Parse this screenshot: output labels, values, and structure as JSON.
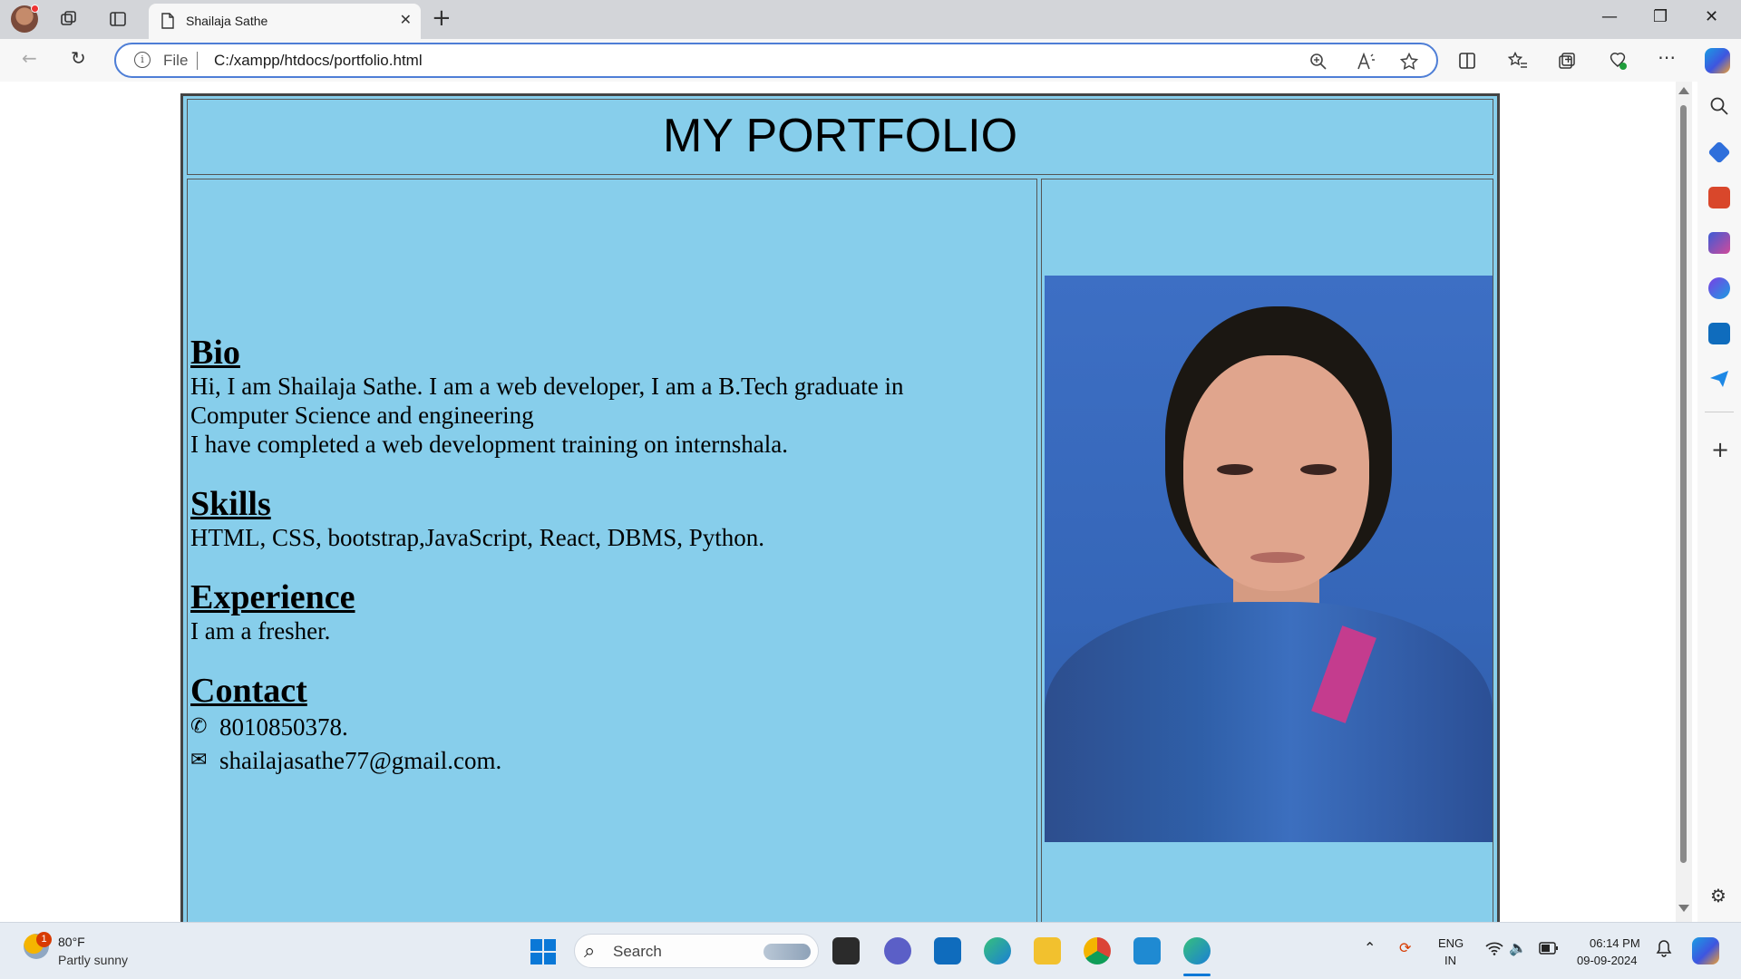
{
  "browser": {
    "tab_title": "Shailaja Sathe",
    "tab_close": "✕",
    "new_tab": "+",
    "address_scheme_label": "File",
    "address_url": "C:/xampp/htdocs/portfolio.html",
    "window_controls": {
      "minimize": "—",
      "maximize": "❐",
      "close": "✕"
    }
  },
  "page": {
    "title": "MY PORTFOLIO",
    "bio": {
      "heading": "Bio",
      "line1": "Hi, I am Shailaja Sathe. I am a web developer, I am a B.Tech graduate in",
      "line2": "Computer Science and engineering",
      "line3": "I have completed a web development training on internshala."
    },
    "skills": {
      "heading": "Skills",
      "text": "HTML, CSS, bootstrap,JavaScript, React, DBMS, Python."
    },
    "experience": {
      "heading": "Experience",
      "text": "I am a fresher."
    },
    "contact": {
      "heading": "Contact",
      "phone_icon": "✆",
      "phone": "8010850378.",
      "email_icon": "✉",
      "email": "shailajasathe77@gmail.com."
    },
    "background_color": "#87ceeb"
  },
  "taskbar": {
    "weather_badge": "1",
    "weather_temp": "80°F",
    "weather_desc": "Partly sunny",
    "search_label": "Search",
    "lang_line1": "ENG",
    "lang_line2": "IN",
    "time": "06:14 PM",
    "date": "09-09-2024"
  }
}
